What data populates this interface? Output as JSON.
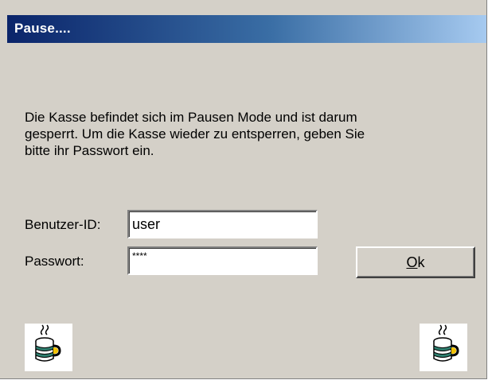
{
  "window": {
    "title": "Pause...."
  },
  "message": {
    "lines": [
      "Die Kasse befindet sich im Pausen Mode und ist darum",
      "gesperrt. Um die Kasse wieder zu entsperren, geben Sie",
      "bitte ihr Passwort ein."
    ]
  },
  "form": {
    "user_label": "Benutzer-ID:",
    "user_value": "user",
    "password_label": "Passwort:",
    "password_value": "****"
  },
  "ok_button": {
    "accelerator": "O",
    "rest": "k"
  },
  "icons": {
    "left": "coffee-cup-icon",
    "right": "coffee-cup-icon"
  },
  "colors": {
    "titlebar_start": "#0a246a",
    "titlebar_end": "#a6caf0",
    "window_background": "#d4d0c8"
  }
}
